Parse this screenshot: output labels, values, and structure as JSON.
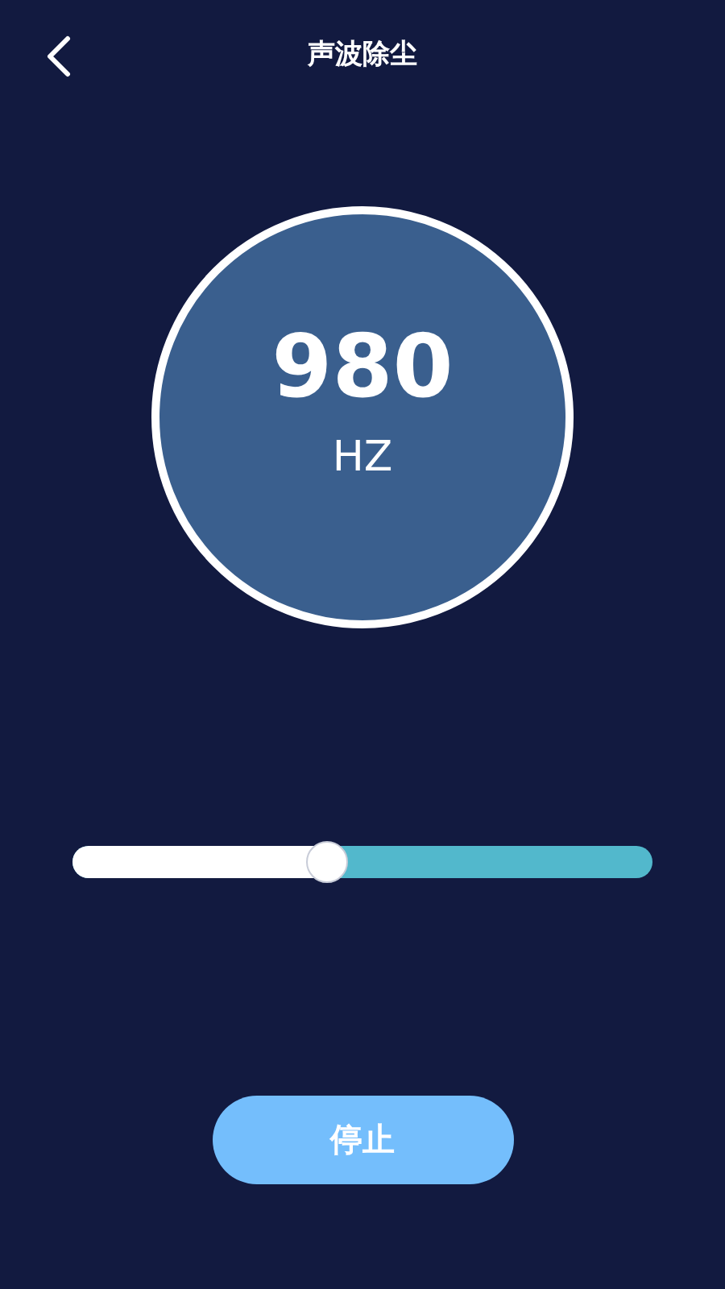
{
  "header": {
    "title": "声波除尘"
  },
  "dial": {
    "value": "980",
    "unit": "HZ"
  },
  "slider": {
    "level": 0.44
  },
  "button": {
    "label": "停止"
  }
}
